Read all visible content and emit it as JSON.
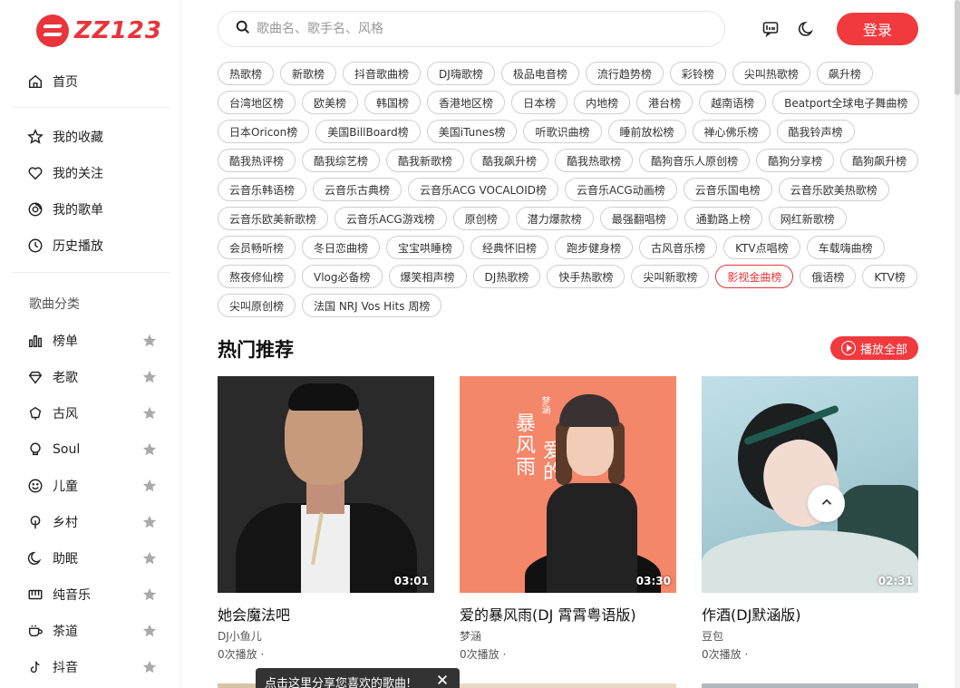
{
  "brand": {
    "logo_text": "ZZ123",
    "color": "#e8343a"
  },
  "sidebar": {
    "top": [
      {
        "label": "首页",
        "icon": "home-icon"
      }
    ],
    "mine": [
      {
        "label": "我的收藏",
        "icon": "star-outline-icon"
      },
      {
        "label": "我的关注",
        "icon": "heart-icon"
      },
      {
        "label": "我的歌单",
        "icon": "playlist-icon"
      },
      {
        "label": "历史播放",
        "icon": "clock-icon"
      }
    ],
    "section_title": "歌曲分类",
    "categories": [
      {
        "label": "榜单",
        "icon": "chart-bars-icon"
      },
      {
        "label": "老歌",
        "icon": "diamond-icon"
      },
      {
        "label": "古风",
        "icon": "lantern-icon"
      },
      {
        "label": "Soul",
        "icon": "bulb-icon"
      },
      {
        "label": "儿童",
        "icon": "smile-icon"
      },
      {
        "label": "乡村",
        "icon": "tree-icon"
      },
      {
        "label": "助眠",
        "icon": "moon-icon"
      },
      {
        "label": "纯音乐",
        "icon": "piano-icon"
      },
      {
        "label": "茶道",
        "icon": "tea-cup-icon"
      },
      {
        "label": "抖音",
        "icon": "tiktok-icon"
      }
    ]
  },
  "header": {
    "search_placeholder": "歌曲名、歌手名、风格",
    "login_label": "登录",
    "accent": "#f03a3e"
  },
  "tags": [
    "热歌榜",
    "新歌榜",
    "抖音歌曲榜",
    "DJ嗨歌榜",
    "极品电音榜",
    "流行趋势榜",
    "彩铃榜",
    "尖叫热歌榜",
    "飙升榜",
    "台湾地区榜",
    "欧美榜",
    "韩国榜",
    "香港地区榜",
    "日本榜",
    "内地榜",
    "港台榜",
    "越南语榜",
    "Beatport全球电子舞曲榜",
    "日本Oricon榜",
    "美国BillBoard榜",
    "美国iTunes榜",
    "听歌识曲榜",
    "睡前放松榜",
    "禅心佛乐榜",
    "酷我铃声榜",
    "酷我热评榜",
    "酷我综艺榜",
    "酷我新歌榜",
    "酷我飙升榜",
    "酷我热歌榜",
    "酷狗音乐人原创榜",
    "酷狗分享榜",
    "酷狗飙升榜",
    "云音乐韩语榜",
    "云音乐古典榜",
    "云音乐ACG VOCALOID榜",
    "云音乐ACG动画榜",
    "云音乐国电榜",
    "云音乐欧美热歌榜",
    "云音乐欧美新歌榜",
    "云音乐ACG游戏榜",
    "原创榜",
    "潜力爆款榜",
    "最强翻唱榜",
    "通勤路上榜",
    "网红新歌榜",
    "会员畅听榜",
    "冬日恋曲榜",
    "宝宝哄睡榜",
    "经典怀旧榜",
    "跑步健身榜",
    "古风音乐榜",
    "KTV点唱榜",
    "车载嗨曲榜",
    "熬夜修仙榜",
    "Vlog必备榜",
    "爆笑相声榜",
    "DJ热歌榜",
    "快手热歌榜",
    "尖叫新歌榜",
    "影视金曲榜",
    "俄语榜",
    "KTV榜",
    "尖叫原创榜",
    "法国 NRJ Vos Hits 周榜"
  ],
  "active_tag": "影视金曲榜",
  "hot": {
    "title": "热门推荐",
    "play_all": "播放全部",
    "songs": [
      {
        "title": "她会魔法吧",
        "artist": "DJ小鱼儿",
        "plays": "0次播放 ·",
        "duration": "03:01"
      },
      {
        "title": "爱的暴风雨(DJ 霄霄粤语版)",
        "artist": "梦涵",
        "plays": "0次播放 ·",
        "duration": "03:30",
        "cover_text_1": "暴风雨",
        "cover_text_2": "爱的",
        "cover_name": "梦涵"
      },
      {
        "title": "作酒(DJ默涵版)",
        "artist": "豆包",
        "plays": "0次播放 ·",
        "duration": "02:31"
      }
    ]
  },
  "toast": {
    "text": "点击这里分享您喜欢的歌曲!"
  }
}
